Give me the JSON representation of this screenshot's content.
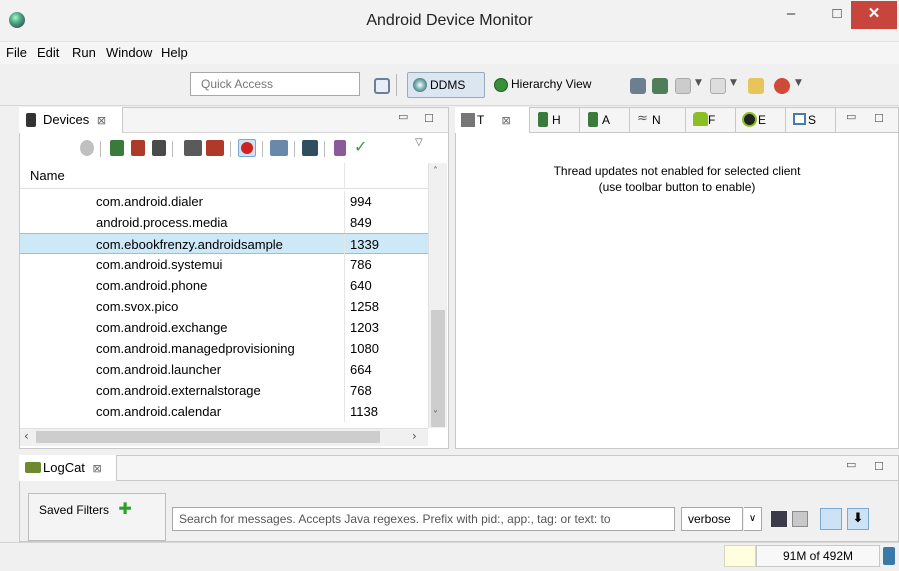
{
  "window": {
    "title": "Android Device Monitor",
    "minimize": "–",
    "maximize": "□",
    "close": "✕"
  },
  "menu": [
    "File",
    "Edit",
    "Run",
    "Window",
    "Help"
  ],
  "toolbar": {
    "quick_access_placeholder": "Quick Access",
    "ddms_label": "DDMS",
    "hierarchy_label": "Hierarchy View"
  },
  "devices_view": {
    "tab_label": "Devices",
    "close_glyph": "⊠",
    "column_name": "Name",
    "rows": [
      {
        "name": "com.android.dialer",
        "pid": "994"
      },
      {
        "name": "android.process.media",
        "pid": "849"
      },
      {
        "name": "com.ebookfrenzy.androidsample",
        "pid": "1339"
      },
      {
        "name": "com.android.systemui",
        "pid": "786"
      },
      {
        "name": "com.android.phone",
        "pid": "640"
      },
      {
        "name": "com.svox.pico",
        "pid": "1258"
      },
      {
        "name": "com.android.exchange",
        "pid": "1203"
      },
      {
        "name": "com.android.managedprovisioning",
        "pid": "1080"
      },
      {
        "name": "com.android.launcher",
        "pid": "664"
      },
      {
        "name": "com.android.externalstorage",
        "pid": "768"
      },
      {
        "name": "com.android.calendar",
        "pid": "1138"
      }
    ],
    "selected_index": 2
  },
  "threads_view": {
    "tabs": [
      {
        "label": "T",
        "icon": "threads-icon"
      },
      {
        "label": "H",
        "icon": "heap-icon"
      },
      {
        "label": "A",
        "icon": "allocation-icon"
      },
      {
        "label": "N",
        "icon": "network-icon"
      },
      {
        "label": "F",
        "icon": "file-explorer-icon"
      },
      {
        "label": "E",
        "icon": "emulator-icon"
      },
      {
        "label": "S",
        "icon": "system-info-icon"
      }
    ],
    "message_line1": "Thread updates not enabled for selected client",
    "message_line2": "(use toolbar button to enable)"
  },
  "logcat": {
    "tab_label": "LogCat",
    "saved_filters_label": "Saved Filters",
    "search_placeholder": "Search for messages. Accepts Java regexes. Prefix with pid:, app:, tag: or text: to",
    "level_value": "verbose"
  },
  "status": {
    "heap": "91M of 492M"
  },
  "colors": {
    "selection": "#cde8f7",
    "close_button": "#c7453c",
    "ddms_active": "#dbe6f1"
  }
}
